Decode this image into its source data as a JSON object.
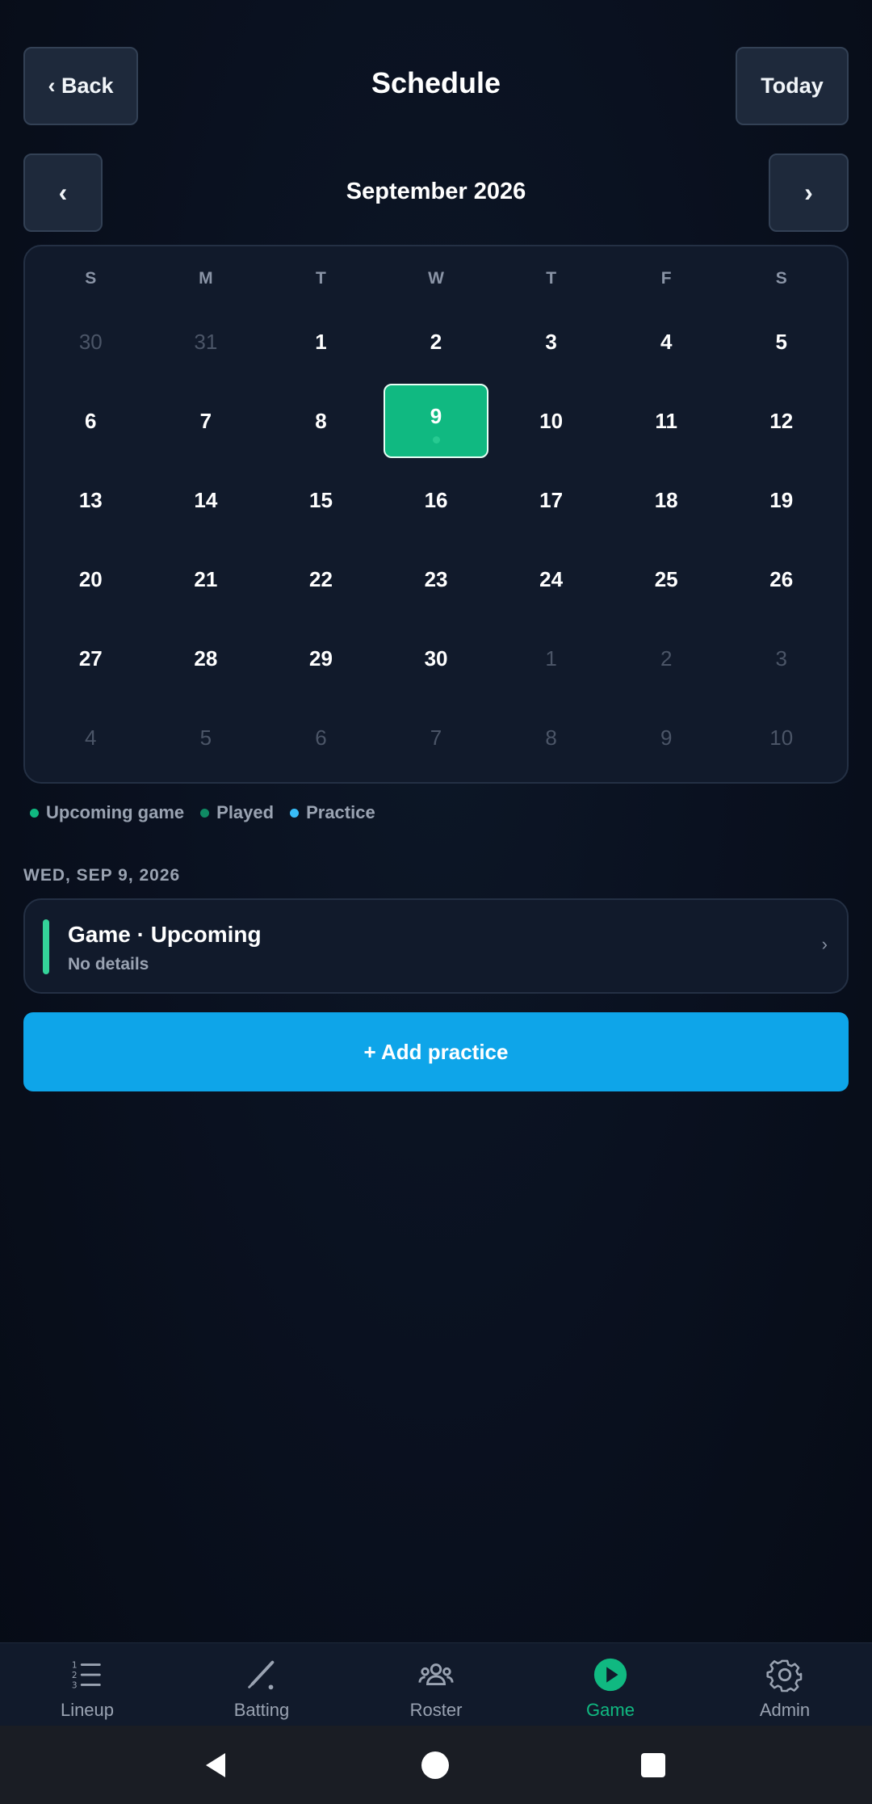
{
  "header": {
    "back_label": "‹ Back",
    "title": "Schedule",
    "today_label": "Today"
  },
  "month_nav": {
    "prev_label": "‹",
    "month_label": "September 2026",
    "next_label": "›"
  },
  "calendar": {
    "weekdays": [
      "S",
      "M",
      "T",
      "W",
      "T",
      "F",
      "S"
    ],
    "weeks": [
      [
        {
          "d": "30",
          "m": true
        },
        {
          "d": "31",
          "m": true
        },
        {
          "d": "1"
        },
        {
          "d": "2"
        },
        {
          "d": "3"
        },
        {
          "d": "4"
        },
        {
          "d": "5"
        }
      ],
      [
        {
          "d": "6"
        },
        {
          "d": "7"
        },
        {
          "d": "8"
        },
        {
          "d": "9",
          "selected": true,
          "dot": true
        },
        {
          "d": "10"
        },
        {
          "d": "11"
        },
        {
          "d": "12"
        }
      ],
      [
        {
          "d": "13"
        },
        {
          "d": "14"
        },
        {
          "d": "15"
        },
        {
          "d": "16"
        },
        {
          "d": "17"
        },
        {
          "d": "18"
        },
        {
          "d": "19"
        }
      ],
      [
        {
          "d": "20"
        },
        {
          "d": "21"
        },
        {
          "d": "22"
        },
        {
          "d": "23"
        },
        {
          "d": "24"
        },
        {
          "d": "25"
        },
        {
          "d": "26"
        }
      ],
      [
        {
          "d": "27"
        },
        {
          "d": "28"
        },
        {
          "d": "29"
        },
        {
          "d": "30"
        },
        {
          "d": "1",
          "m": true
        },
        {
          "d": "2",
          "m": true
        },
        {
          "d": "3",
          "m": true
        }
      ],
      [
        {
          "d": "4",
          "m": true
        },
        {
          "d": "5",
          "m": true
        },
        {
          "d": "6",
          "m": true
        },
        {
          "d": "7",
          "m": true
        },
        {
          "d": "8",
          "m": true
        },
        {
          "d": "9",
          "m": true
        },
        {
          "d": "10",
          "m": true
        }
      ]
    ]
  },
  "legend": [
    {
      "label": "Upcoming game",
      "color": "#10b981"
    },
    {
      "label": "Played",
      "color": "#0f8a63"
    },
    {
      "label": "Practice",
      "color": "#38bdf8"
    }
  ],
  "selected_date_heading": "WED, SEP 9, 2026",
  "event": {
    "title": "Game · Upcoming",
    "subtitle": "No details",
    "chevron": "›",
    "accent": "#34d399"
  },
  "add_practice_label": "+ Add practice",
  "bottom_nav": [
    {
      "label": "Lineup",
      "icon": "list-icon"
    },
    {
      "label": "Batting",
      "icon": "bat-icon"
    },
    {
      "label": "Roster",
      "icon": "group-icon"
    },
    {
      "label": "Game",
      "icon": "play-circle-icon",
      "active": true
    },
    {
      "label": "Admin",
      "icon": "gear-icon"
    }
  ],
  "colors": {
    "accent": "#10b981",
    "primary_button": "#0ea5e9"
  }
}
